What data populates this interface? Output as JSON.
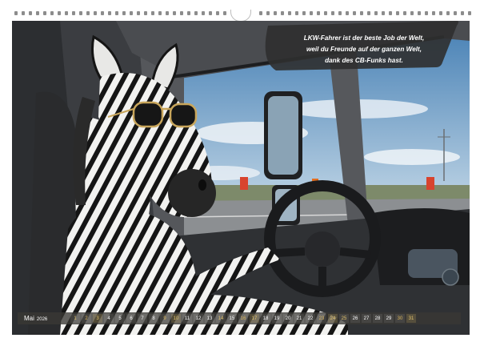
{
  "quote": {
    "lines": [
      "LKW-Fahrer ist der beste Job der Welt,",
      "weil du Freunde auf der ganzen Welt,",
      "dank des CB-Funks hast."
    ]
  },
  "calendar": {
    "month": "Mai",
    "year": "2026",
    "days": [
      {
        "n": "1",
        "type": "holiday"
      },
      {
        "n": "2",
        "type": "sat"
      },
      {
        "n": "3",
        "type": "sun"
      },
      {
        "n": "4",
        "type": "normal"
      },
      {
        "n": "5",
        "type": "normal"
      },
      {
        "n": "6",
        "type": "normal"
      },
      {
        "n": "7",
        "type": "normal"
      },
      {
        "n": "8",
        "type": "normal"
      },
      {
        "n": "9",
        "type": "sat"
      },
      {
        "n": "10",
        "type": "sun"
      },
      {
        "n": "11",
        "type": "normal"
      },
      {
        "n": "12",
        "type": "normal"
      },
      {
        "n": "13",
        "type": "normal"
      },
      {
        "n": "14",
        "type": "holiday"
      },
      {
        "n": "15",
        "type": "normal"
      },
      {
        "n": "16",
        "type": "sat"
      },
      {
        "n": "17",
        "type": "sun"
      },
      {
        "n": "18",
        "type": "normal"
      },
      {
        "n": "19",
        "type": "normal"
      },
      {
        "n": "20",
        "type": "normal"
      },
      {
        "n": "21",
        "type": "normal"
      },
      {
        "n": "22",
        "type": "normal"
      },
      {
        "n": "23",
        "type": "sat"
      },
      {
        "n": "24",
        "type": "sun"
      },
      {
        "n": "25",
        "type": "holiday"
      },
      {
        "n": "26",
        "type": "normal"
      },
      {
        "n": "27",
        "type": "normal"
      },
      {
        "n": "28",
        "type": "normal"
      },
      {
        "n": "29",
        "type": "normal"
      },
      {
        "n": "30",
        "type": "sat"
      },
      {
        "n": "31",
        "type": "sun"
      }
    ]
  },
  "colors": {
    "banner": "#2f2f2f",
    "strip": "#3a3834",
    "weekend_accent": "#e2c36c"
  }
}
